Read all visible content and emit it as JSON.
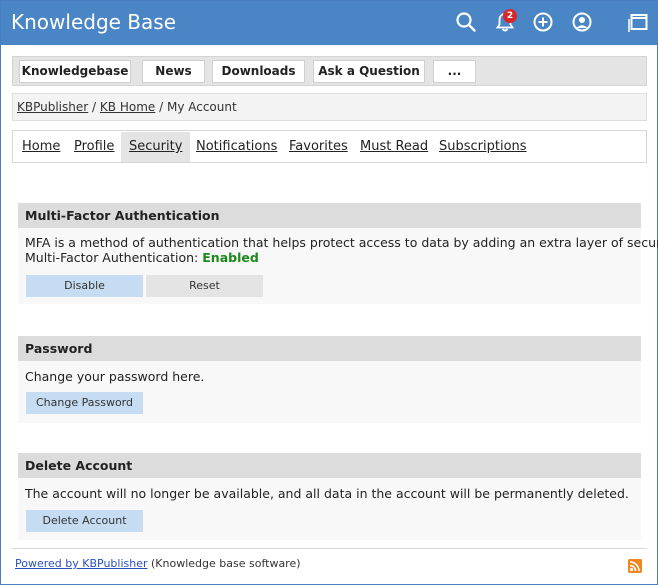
{
  "header": {
    "title": "Knowledge Base",
    "notification_count": "2",
    "accent": "#4a86c5",
    "icons": [
      "search-icon",
      "bell-icon",
      "plus-circle-icon",
      "user-icon",
      "window-icon"
    ]
  },
  "menu": {
    "items": [
      {
        "label": "Knowledgebase"
      },
      {
        "label": "News"
      },
      {
        "label": "Downloads"
      },
      {
        "label": "Ask a Question"
      },
      {
        "label": "..."
      }
    ]
  },
  "breadcrumb": {
    "items": [
      "KBPublisher",
      "KB Home"
    ],
    "separator": "/",
    "current": "My Account"
  },
  "tabs": {
    "items": [
      {
        "label": "Home"
      },
      {
        "label": "Profile"
      },
      {
        "label": "Security"
      },
      {
        "label": "Notifications"
      },
      {
        "label": "Favorites"
      },
      {
        "label": "Must Read"
      },
      {
        "label": "Subscriptions"
      }
    ],
    "active": "Security"
  },
  "mfa": {
    "title": "Multi-Factor Authentication",
    "description": "MFA is a method of authentication that helps protect access to data by adding an extra layer of security.",
    "status_label": "Multi-Factor Authentication:",
    "status_value": "Enabled",
    "status_color": "#1a8a1a",
    "disable_label": "Disable",
    "reset_label": "Reset"
  },
  "password": {
    "title": "Password",
    "description": "Change your password here.",
    "button_label": "Change Password"
  },
  "delete_account": {
    "title": "Delete Account",
    "description": "The account will no longer be available, and all data in the account will be permanently deleted.",
    "button_label": "Delete Account"
  },
  "footer": {
    "link_text": "Powered by KBPublisher",
    "suffix": "(Knowledge base software)",
    "icon": "rss-icon"
  }
}
